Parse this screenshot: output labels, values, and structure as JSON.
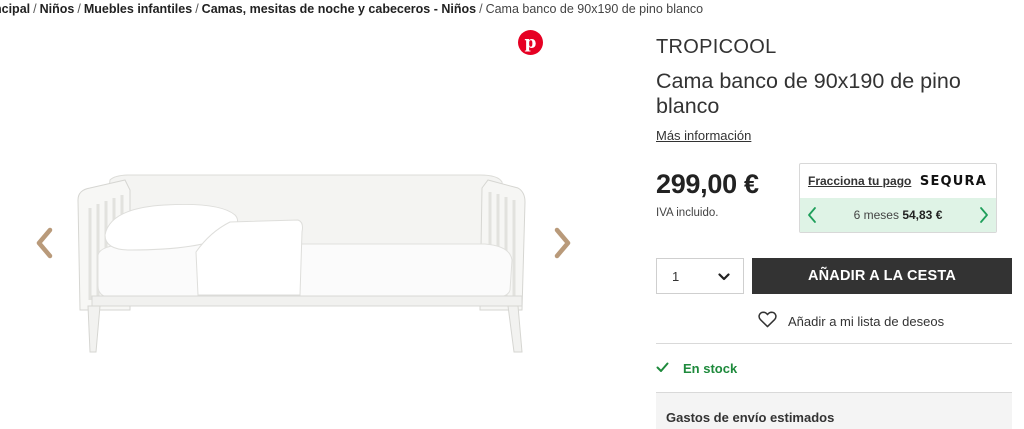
{
  "breadcrumb": {
    "items": [
      "ncipal",
      "Niños",
      "Muebles infantiles",
      "Camas, mesitas de noche y cabeceros - Niños"
    ],
    "current": "Cama banco de 90x190 de pino blanco",
    "separator": "/"
  },
  "gallery": {
    "share_icon": "pinterest-icon",
    "prev_icon": "chevron-left-icon",
    "next_icon": "chevron-right-icon",
    "arrow_color": "#b99a7a"
  },
  "product": {
    "brand": "TROPICOOL",
    "title": "Cama banco de 90x190 de pino blanco",
    "more_info": "Más información",
    "price": "299,00 €",
    "vat_note": "IVA incluido."
  },
  "sequra": {
    "label": "Fracciona tu pago",
    "logo": "SEQURA",
    "months": "6 meses",
    "amount": "54,83 €",
    "accent": "#1e9e5a",
    "background": "#dff3e6"
  },
  "purchase": {
    "quantity": "1",
    "add_to_cart": "AÑADIR A LA CESTA",
    "wishlist": "Añadir a mi lista de deseos"
  },
  "availability": {
    "stock": "En stock",
    "stock_color": "#1e8a3c"
  },
  "shipping": {
    "title": "Gastos de envío estimados"
  }
}
